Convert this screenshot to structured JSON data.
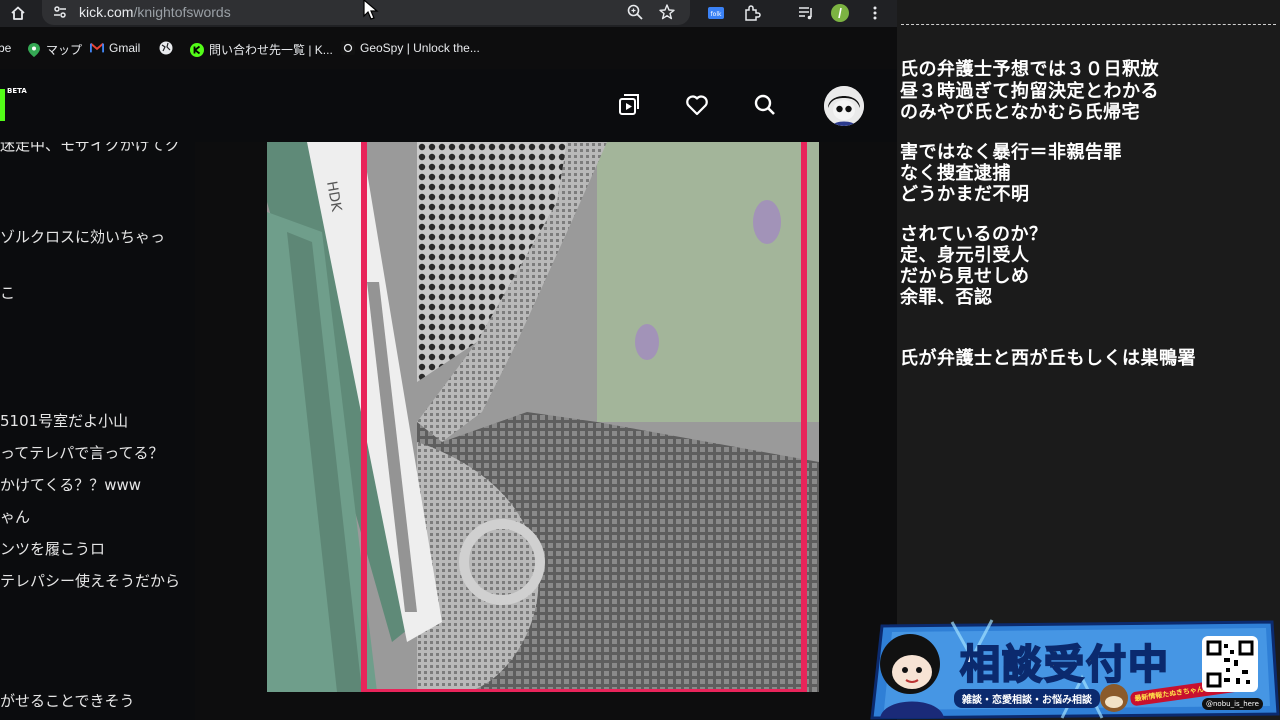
{
  "browser": {
    "url_host": "kick.com",
    "url_path": "/knightofswords",
    "bookmarks": [
      {
        "label": "be"
      },
      {
        "label": "マップ"
      },
      {
        "label": "Gmail"
      },
      {
        "label": ""
      },
      {
        "label": "問い合わせ先一覧 | K..."
      },
      {
        "label": "GeoSpy | Unlock the..."
      }
    ]
  },
  "kick": {
    "beta_label": "BETA"
  },
  "chat": {
    "lines": [
      "迷走中、モザイクかけてク",
      "ゾルクロスに効いちゃっ",
      "こ",
      "5101号室だよ小山",
      "ってテレパで言ってる？",
      "かけてくる？？www",
      "ゃん",
      "ンツを履こうロ",
      "テレパシー使えそうだから",
      "がせることできそう"
    ]
  },
  "notes": {
    "lines": [
      "氏の弁護士予想では３０日釈放",
      "昼３時過ぎて拘留決定とわかる",
      "のみやび氏となかむら氏帰宅",
      "害ではなく暴行＝非親告罪",
      "なく捜査逮捕",
      "どうかまだ不明",
      "されているのか？",
      "定、身元引受人",
      "だから見せしめ",
      "余罪、否認",
      "氏が弁護士と西が丘もしくは巣鴨署"
    ]
  },
  "banner": {
    "title_part1": "相談",
    "title_part2": "受付中",
    "subtitle": "雑談・恋愛相談・お悩み相談",
    "promo": "最新情報たぬきちゃんねるはこちら!",
    "handle": "@nobu_is_here"
  },
  "colors": {
    "kick_green": "#53fc18",
    "video_border": "#e8245a",
    "banner_blue": "#0b2a6e",
    "banner_yellow": "#ffe14a"
  }
}
